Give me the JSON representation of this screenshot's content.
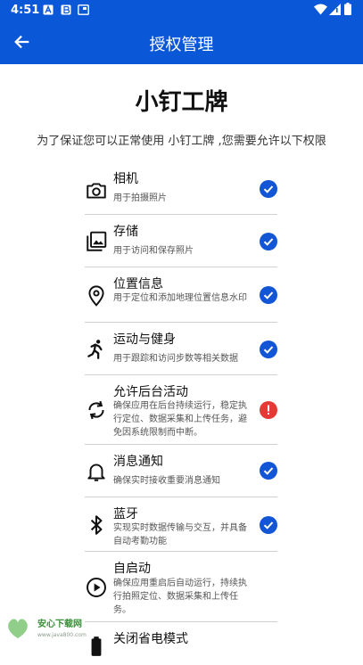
{
  "status_bar": {
    "time": "4:51"
  },
  "header": {
    "title": "授权管理"
  },
  "app_name": "小钉工牌",
  "intro": "为了保证您可以正常使用 小钉工牌 ,您需要允许以下权限",
  "permissions": [
    {
      "name": "相机",
      "desc": "用于拍摄照片",
      "icon": "camera-icon",
      "status": "granted"
    },
    {
      "name": "存储",
      "desc": "用于访问和保存照片",
      "icon": "photo-library-icon",
      "status": "granted"
    },
    {
      "name": "位置信息",
      "desc": "用于定位和添加地理位置信息水印",
      "icon": "location-pin-icon",
      "status": "granted"
    },
    {
      "name": "运动与健身",
      "desc": "用于跟踪和访问步数等相关数据",
      "icon": "running-person-icon",
      "status": "granted"
    },
    {
      "name": "允许后台活动",
      "desc": "确保应用在后台持续运行，稳定执行定位、数据采集和上传任务，避免因系统限制而中断。",
      "icon": "sync-icon",
      "status": "warning"
    },
    {
      "name": "消息通知",
      "desc": "确保实时接收重要消息通知",
      "icon": "bell-icon",
      "status": "granted"
    },
    {
      "name": "蓝牙",
      "desc": "实现实时数据传输与交互，并具备自动考勤功能",
      "icon": "bluetooth-icon",
      "status": "granted"
    },
    {
      "name": "自启动",
      "desc": "确保应用重启后自动运行，持续执行拍照定位、数据采集和上传任务。",
      "icon": "play-circle-icon",
      "status": "none"
    },
    {
      "name": "关闭省电模式",
      "desc": "",
      "icon": "battery-icon",
      "status": "none"
    }
  ],
  "watermark": {
    "brand": "安心下载网",
    "url": "www.java800.com"
  },
  "colors": {
    "primary": "#0a57d8",
    "check": "#1256d6",
    "warning": "#e53935"
  }
}
